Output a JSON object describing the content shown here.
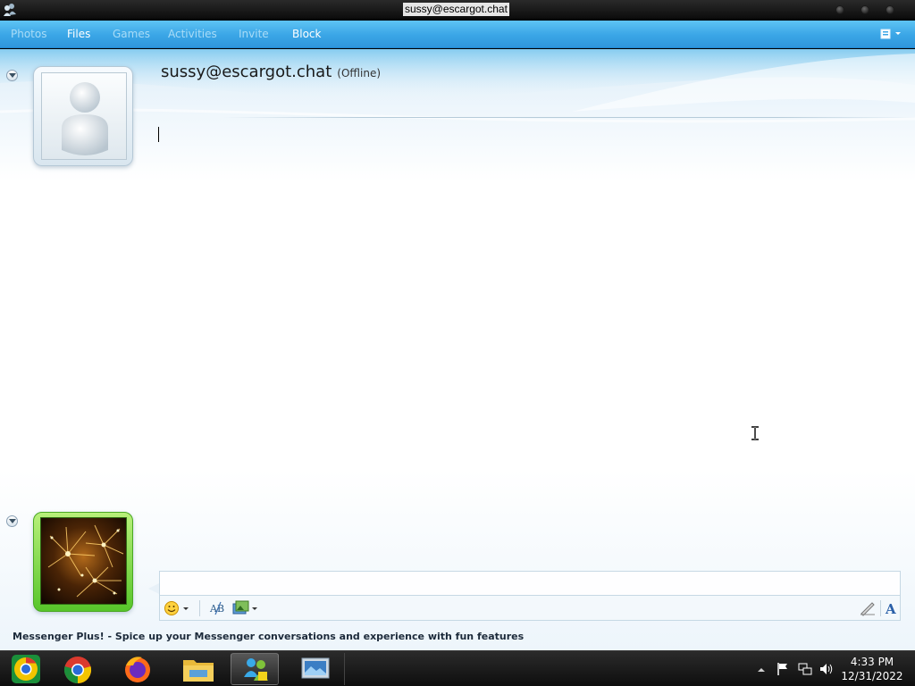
{
  "window": {
    "title": "sussy@escargot.chat"
  },
  "toolbar": {
    "items": [
      {
        "label": "Photos",
        "enabled": false
      },
      {
        "label": "Files",
        "enabled": true
      },
      {
        "label": "Games",
        "enabled": false
      },
      {
        "label": "Activities",
        "enabled": false
      },
      {
        "label": "Invite",
        "enabled": false
      },
      {
        "label": "Block",
        "enabled": true
      }
    ],
    "menu_icon": "show-menu-icon"
  },
  "contact": {
    "name": "sussy@escargot.chat",
    "status": "(Offline)",
    "avatar_icon": "default-user-avatar-icon"
  },
  "self": {
    "avatar_icon": "fireworks-display-picture"
  },
  "compose": {
    "value": "",
    "tools": [
      "emoticon-icon",
      "spellcheck-icon",
      "backgrounds-icon",
      "handwriting-icon",
      "font-icon"
    ]
  },
  "status_bar": {
    "text": "Messenger Plus! - Spice up your Messenger conversations and experience with fun features"
  },
  "taskbar": {
    "apps": [
      "chrome-beta-icon",
      "chrome-icon",
      "firefox-icon",
      "file-explorer-icon",
      "messenger-icon",
      "remote-desktop-icon"
    ],
    "active_app": "messenger-icon",
    "tray": [
      "show-hidden-icons",
      "action-center-flag-icon",
      "network-icon",
      "volume-icon"
    ],
    "time": "4:33 PM",
    "date": "12/31/2022"
  },
  "colors": {
    "toolbar_blue": "#3aa5e6",
    "toolbar_disabled_text": "#a9dcf7",
    "self_frame_green": "#57c52a"
  }
}
